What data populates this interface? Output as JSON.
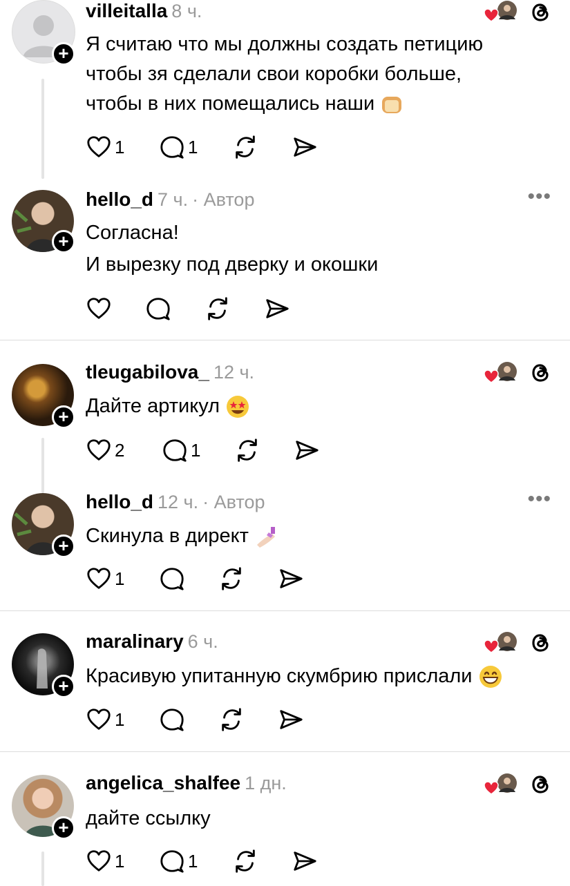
{
  "comments": [
    {
      "username": "villeitalla",
      "time": "8 ч.",
      "author_tag": "",
      "lines": [
        "Я считаю что мы должны создать петицию",
        "чтобы зя сделали свои коробки больше,",
        "чтобы в них помещались наши"
      ],
      "trailing_emoji": "bread-emoji",
      "likes": "1",
      "replies": "1",
      "liked_by_author": true
    },
    {
      "username": "hello_d",
      "time": "7 ч.",
      "author_tag": "· Автор",
      "lines": [
        "Согласна!",
        "И вырезку под дверку и окошки"
      ],
      "likes": "",
      "replies": ""
    },
    {
      "username": "tleugabilova_",
      "time": "12 ч.",
      "author_tag": "",
      "lines": [
        "Дайте артикул"
      ],
      "trailing_emoji": "star-struck-emoji",
      "likes": "2",
      "replies": "1",
      "liked_by_author": true
    },
    {
      "username": "hello_d",
      "time": "12 ч.",
      "author_tag": "· Автор",
      "lines": [
        "Скинула в директ"
      ],
      "trailing_emoji": "nail-polish-emoji",
      "likes": "1",
      "replies": ""
    },
    {
      "username": "maralinary",
      "time": "6 ч.",
      "author_tag": "",
      "lines": [
        "Красивую упитанную скумбрию прислали"
      ],
      "trailing_emoji": "grinning-emoji",
      "likes": "1",
      "replies": "",
      "liked_by_author": true
    },
    {
      "username": "angelica_shalfee",
      "time": "1 дн.",
      "author_tag": "",
      "lines": [
        "дайте ссылку"
      ],
      "likes": "1",
      "replies": "1",
      "liked_by_author": true
    }
  ],
  "icons": {
    "like": "heart-icon",
    "reply": "comment-icon",
    "repost": "repost-icon",
    "share": "send-icon",
    "more": "more-icon",
    "threads": "threads-logo-icon",
    "follow": "plus-icon"
  },
  "colors": {
    "liked_heart": "#e8253b",
    "meta_gray": "#9a9a9a",
    "separator": "#dcdcdc"
  }
}
